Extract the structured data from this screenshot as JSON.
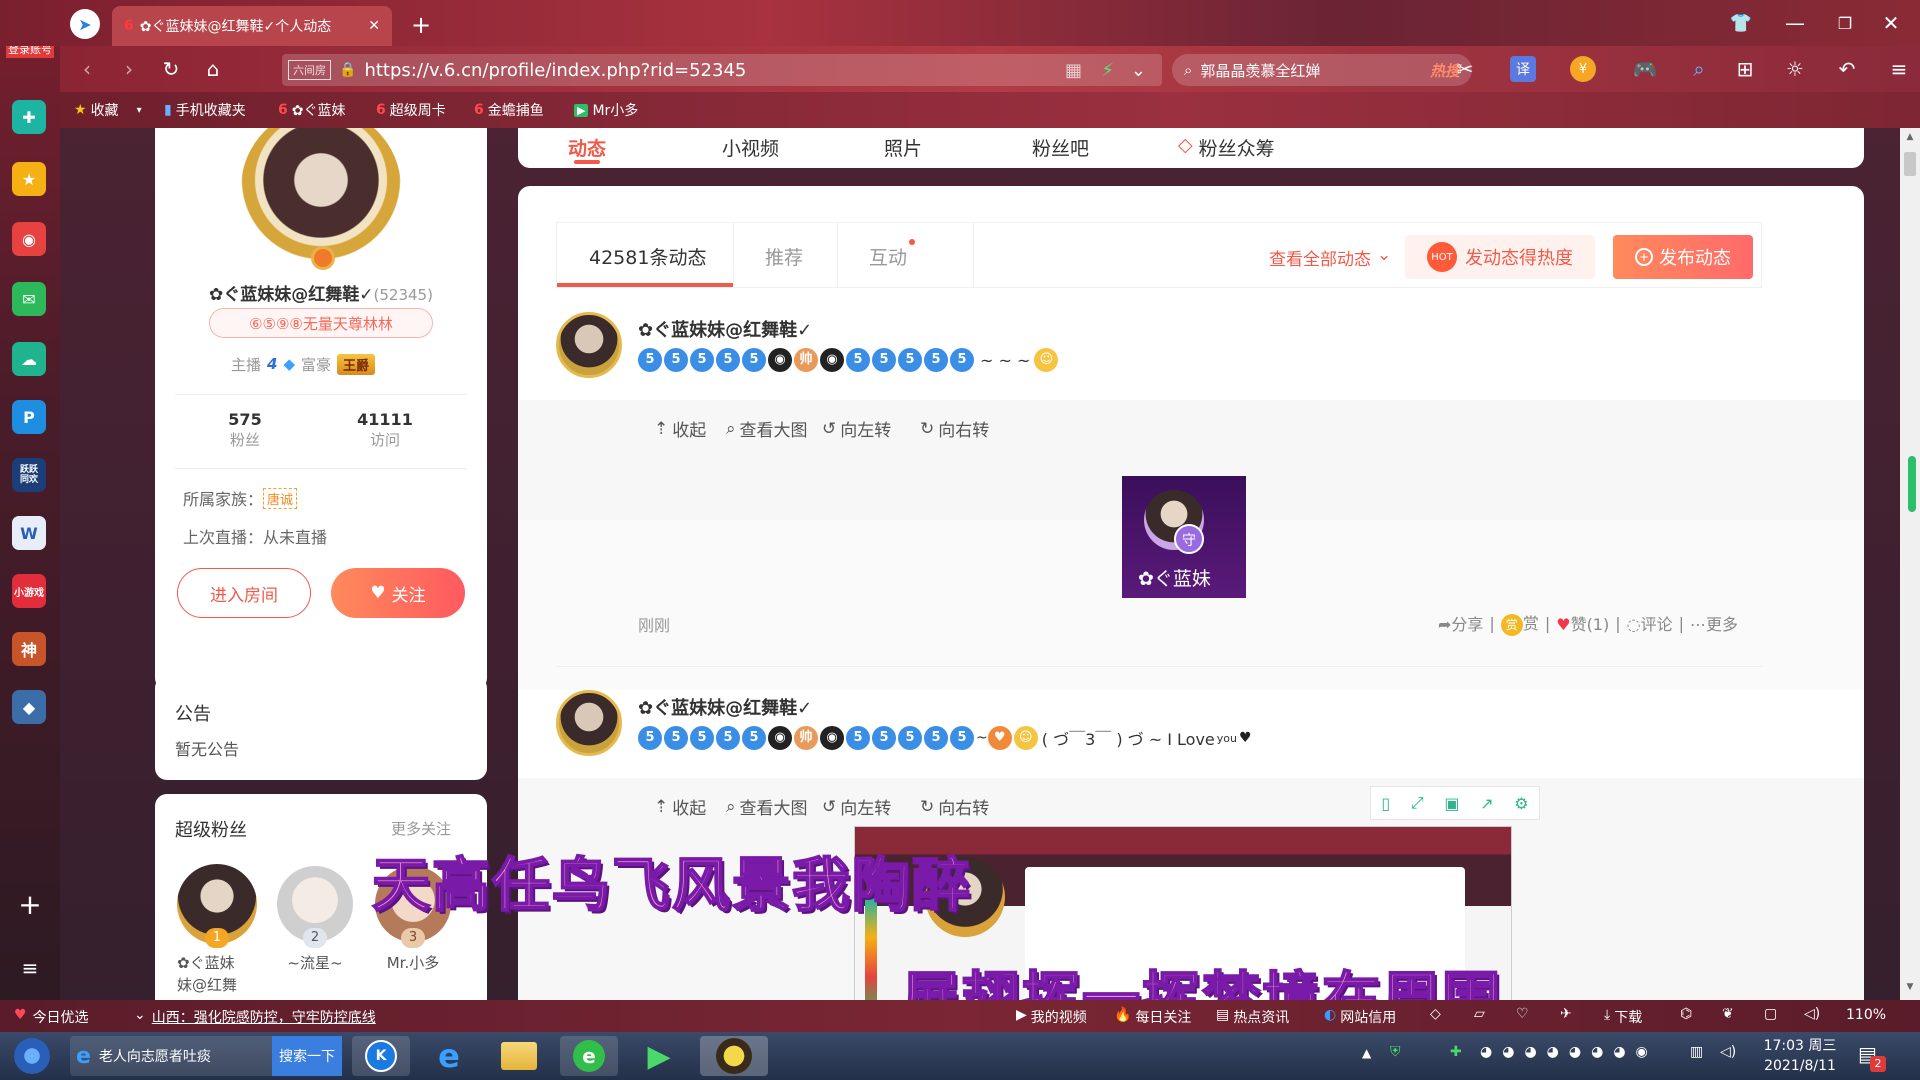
{
  "browser": {
    "login_label": "登录账号",
    "tab_title": "✿ぐ蓝妹妹@红舞鞋✓个人动态",
    "url": "https://v.6.cn/profile/index.php?rid=52345",
    "url_badge": "六间房",
    "search_text": "郭晶晶羡慕全红婵",
    "search_hot": "热搜",
    "bookmarks": [
      "收藏",
      "手机收藏夹",
      "✿ぐ蓝妹",
      "超级周卡",
      "金蟾捕鱼",
      "Mr小多"
    ],
    "translate_label": "译"
  },
  "left_sidebar": {
    "icons": [
      "plus-circle-icon",
      "star-icon",
      "weibo-icon",
      "mail-icon",
      "cloud-icon",
      "p-icon",
      "game-icon",
      "word-icon",
      "mini-icon",
      "god-icon",
      "game2-icon"
    ],
    "game_label": "跃跃\n同欢",
    "mini_label": "小游戏"
  },
  "profile": {
    "name": "✿ぐ蓝妹妹@红舞鞋✓",
    "rid": "(52345)",
    "badge": "⑥⑤⑨⑧无量天尊林林",
    "anchor_label": "主播",
    "anchor_level": "4",
    "rich_label": "富豪",
    "rich_title": "王爵",
    "fans_count": "575",
    "fans_label": "粉丝",
    "visits_count": "41111",
    "visits_label": "访问",
    "family_label": "所属家族：",
    "family_name": "唐诚",
    "last_live": "上次直播：从未直播",
    "enter_room": "进入房间",
    "follow": "关注"
  },
  "notice": {
    "title": "公告",
    "content": "暂无公告"
  },
  "super_fans": {
    "title": "超级粉丝",
    "more": "更多关注",
    "fans": [
      {
        "rank": "1",
        "name": "✿ぐ蓝妹\n妹@红舞"
      },
      {
        "rank": "2",
        "name": "~流星~"
      },
      {
        "rank": "3",
        "name": "Mr.小多"
      }
    ]
  },
  "top_tabs": [
    "动态",
    "小视频",
    "照片",
    "粉丝吧",
    "粉丝众筹"
  ],
  "feed": {
    "tabs": [
      "42581条动态",
      "推荐",
      "互动"
    ],
    "view_all": "查看全部动态",
    "hot_btn": "发动态得热度",
    "post_btn": "发布动态",
    "posts": [
      {
        "author": "✿ぐ蓝妹妹@红舞鞋✓",
        "tail": "~ ~ ~",
        "actions": [
          "收起",
          "查看大图",
          "向左转",
          "向右转"
        ],
        "image_caption": "✿ぐ蓝妹",
        "time": "刚刚",
        "bottom_actions": [
          "分享",
          "赏",
          "赞(1)",
          "评论",
          "更多"
        ]
      },
      {
        "author": "✿ぐ蓝妹妹@红舞鞋✓",
        "tail": "( づ￣3￣ ) づ ~ I Love",
        "tail_sub": "you",
        "actions": [
          "收起",
          "查看大图",
          "向左转",
          "向右转"
        ]
      }
    ]
  },
  "overlay_lyrics": [
    "天高任鸟飞风景我陶醉",
    "展翅挥一挥梦境在周围"
  ],
  "status_bar": {
    "today": "今日优选",
    "news": "山西：强化院感防控，守牢防控底线",
    "items": [
      "我的视频",
      "每日关注",
      "热点资讯",
      "网站信用"
    ],
    "download": "下载",
    "zoom": "110%"
  },
  "taskbar": {
    "ie_task": "老人向志愿者吐痰",
    "search_btn": "搜索一下",
    "time": "17:03 周三",
    "date": "2021/8/11",
    "notif_count": "2"
  },
  "colors": {
    "accent": "#f15a4a",
    "blue_emoji": "#3a8ee6"
  }
}
